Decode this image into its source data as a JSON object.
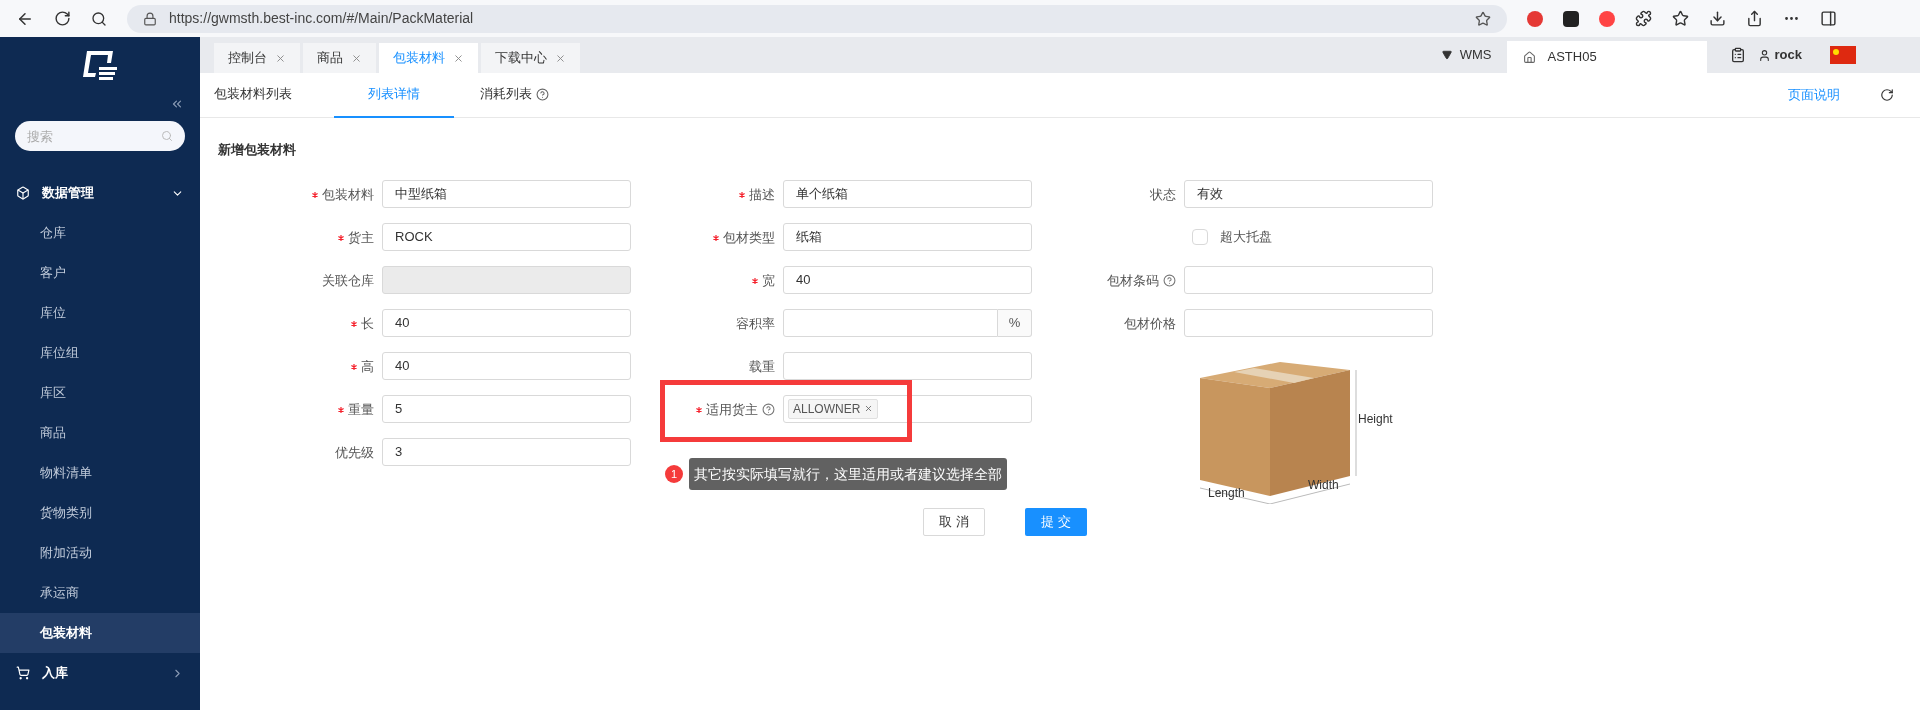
{
  "browser": {
    "url": "https://gwmsth.best-inc.com/#/Main/PackMaterial"
  },
  "sidebar": {
    "search_placeholder": "搜索",
    "items": [
      {
        "label": "数据管理",
        "expanded": true,
        "children": [
          {
            "label": "仓库",
            "selected": false
          },
          {
            "label": "客户",
            "selected": false
          },
          {
            "label": "库位",
            "selected": false
          },
          {
            "label": "库位组",
            "selected": false
          },
          {
            "label": "库区",
            "selected": false
          },
          {
            "label": "商品",
            "selected": false
          },
          {
            "label": "物料清单",
            "selected": false
          },
          {
            "label": "货物类别",
            "selected": false
          },
          {
            "label": "附加活动",
            "selected": false
          },
          {
            "label": "承运商",
            "selected": false
          },
          {
            "label": "包装材料",
            "selected": true
          }
        ]
      },
      {
        "label": "入库",
        "expanded": false
      }
    ]
  },
  "page_tabs": [
    {
      "label": "控制台",
      "selected": false
    },
    {
      "label": "商品",
      "selected": false
    },
    {
      "label": "包装材料",
      "selected": true
    },
    {
      "label": "下载中心",
      "selected": false
    }
  ],
  "header": {
    "system": "WMS",
    "warehouse": "ASTH05",
    "user": "rock"
  },
  "sub_tabs": [
    {
      "label": "包装材料列表",
      "selected": false,
      "help": false
    },
    {
      "label": "列表详情",
      "selected": true,
      "help": false
    },
    {
      "label": "消耗列表",
      "selected": false,
      "help": true
    }
  ],
  "page_help": "页面说明",
  "form": {
    "title": "新增包装材料",
    "columns": [
      [
        {
          "label": "包装材料",
          "required": true,
          "value": "中型纸箱",
          "kind": "input",
          "disabled": false
        },
        {
          "label": "货主",
          "required": true,
          "value": "ROCK",
          "kind": "input",
          "disabled": false
        },
        {
          "label": "关联仓库",
          "required": false,
          "kind": "input",
          "disabled": true
        },
        {
          "label": "长",
          "required": true,
          "value": "40",
          "kind": "input",
          "disabled": false
        },
        {
          "label": "高",
          "required": true,
          "value": "40",
          "kind": "input",
          "disabled": false
        },
        {
          "label": "重量",
          "required": true,
          "value": "5",
          "kind": "input",
          "disabled": false
        },
        {
          "label": "优先级",
          "required": false,
          "value": "3",
          "kind": "input",
          "disabled": false
        }
      ],
      [
        {
          "label": "描述",
          "required": true,
          "value": "单个纸箱",
          "kind": "input",
          "disabled": false
        },
        {
          "label": "包材类型",
          "required": true,
          "value": "纸箱",
          "kind": "input",
          "disabled": false
        },
        {
          "label": "宽",
          "required": true,
          "value": "40",
          "kind": "input",
          "disabled": false
        },
        {
          "label": "容积率",
          "required": false,
          "kind": "suffix",
          "suffix": "%",
          "disabled": false
        },
        {
          "label": "载重",
          "required": false,
          "kind": "input",
          "disabled": false
        },
        {
          "label": "适用货主",
          "required": true,
          "help": true,
          "kind": "tags",
          "tags": [
            "ALLOWNER"
          ]
        }
      ],
      [
        {
          "label": "状态",
          "required": false,
          "value": "有效",
          "kind": "input",
          "disabled": false
        },
        {
          "label": "超大托盘",
          "kind": "checkbox",
          "checked": false
        },
        {
          "label": "包材条码",
          "required": false,
          "help": true,
          "kind": "input",
          "disabled": false
        },
        {
          "label": "包材价格",
          "required": false,
          "kind": "input",
          "disabled": false
        }
      ]
    ],
    "diagram": {
      "height": "Height",
      "length": "Length",
      "width": "Width"
    },
    "buttons": [
      {
        "label": "取 消",
        "kind": "secondary"
      },
      {
        "label": "提 交",
        "kind": "primary"
      }
    ]
  },
  "annotation": {
    "number": "1",
    "text": "其它按实际填写就行，这里适用或者建议选择全部"
  }
}
